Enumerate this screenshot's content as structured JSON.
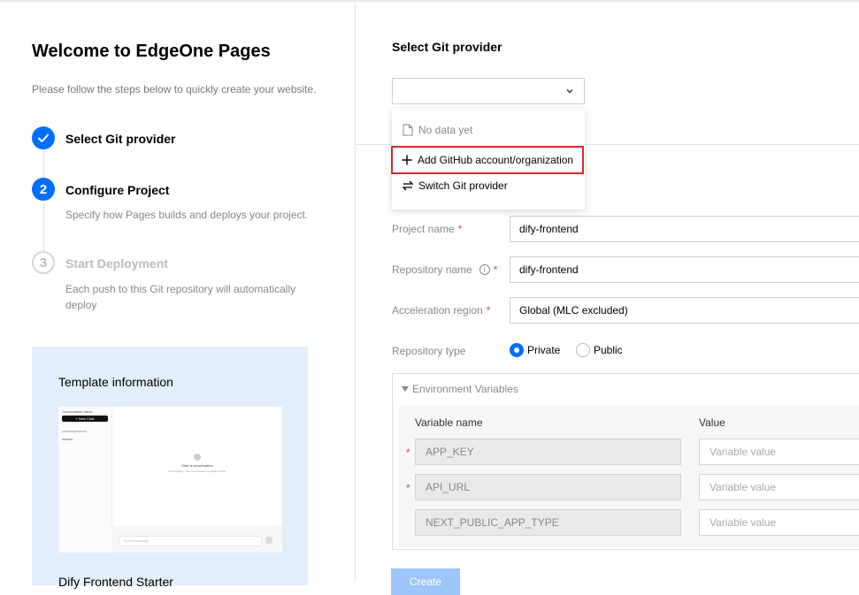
{
  "left": {
    "welcome_title": "Welcome to EdgeOne Pages",
    "subtitle": "Please follow the steps below to quickly create your website.",
    "steps": [
      {
        "number": "1",
        "title": "Select Git provider",
        "description": "",
        "state": "done"
      },
      {
        "number": "2",
        "title": "Configure Project",
        "description": "Specify how Pages builds and deploys your project.",
        "state": "active"
      },
      {
        "number": "3",
        "title": "Start Deployment",
        "description": "Each push to this Git repository will automatically deploy",
        "state": "pending"
      }
    ],
    "template": {
      "heading": "Template information",
      "name": "Dify Frontend Starter",
      "thumb": {
        "sidebar_title": "Conversation Inbox",
        "new_chat": "+ New Chat",
        "start_heading": "Start a conversation",
        "start_desc": "Ask anything. Your conversation is private to Dify.",
        "input_placeholder": "Type a message"
      }
    }
  },
  "right": {
    "provider_section_title": "Select Git provider",
    "provider_select_value": "",
    "dropdown": {
      "empty_text": "No data yet",
      "add_label": "Add GitHub account/organization",
      "switch_label": "Switch Git provider"
    },
    "form": {
      "project_name_label": "Project name",
      "project_name_value": "dify-frontend",
      "repo_name_label": "Repository name",
      "repo_name_value": "dify-frontend",
      "accel_region_label": "Acceleration region",
      "accel_region_value": "Global (MLC excluded)",
      "repo_type_label": "Repository type",
      "repo_type_options": [
        "Private",
        "Public"
      ],
      "repo_type_selected": "Private"
    },
    "env": {
      "header": "Environment Variables",
      "col_name": "Variable name",
      "col_value": "Value",
      "rows": [
        {
          "name": "APP_KEY",
          "value_placeholder": "Variable value",
          "required": true
        },
        {
          "name": "API_URL",
          "value_placeholder": "Variable value",
          "required": true
        },
        {
          "name": "NEXT_PUBLIC_APP_TYPE",
          "value_placeholder": "Variable value",
          "required": false
        }
      ]
    },
    "create_label": "Create"
  },
  "colors": {
    "accent": "#006eff",
    "highlight_border": "#e0262a",
    "required": "#e54545",
    "template_bg": "#e3eefc"
  },
  "icons": {
    "step_done": "check-icon",
    "select_chevron": "chevron-down-icon",
    "empty": "document-icon",
    "add": "plus-icon",
    "switch": "swap-icon",
    "info": "info-icon",
    "collapse": "caret-down-icon"
  }
}
